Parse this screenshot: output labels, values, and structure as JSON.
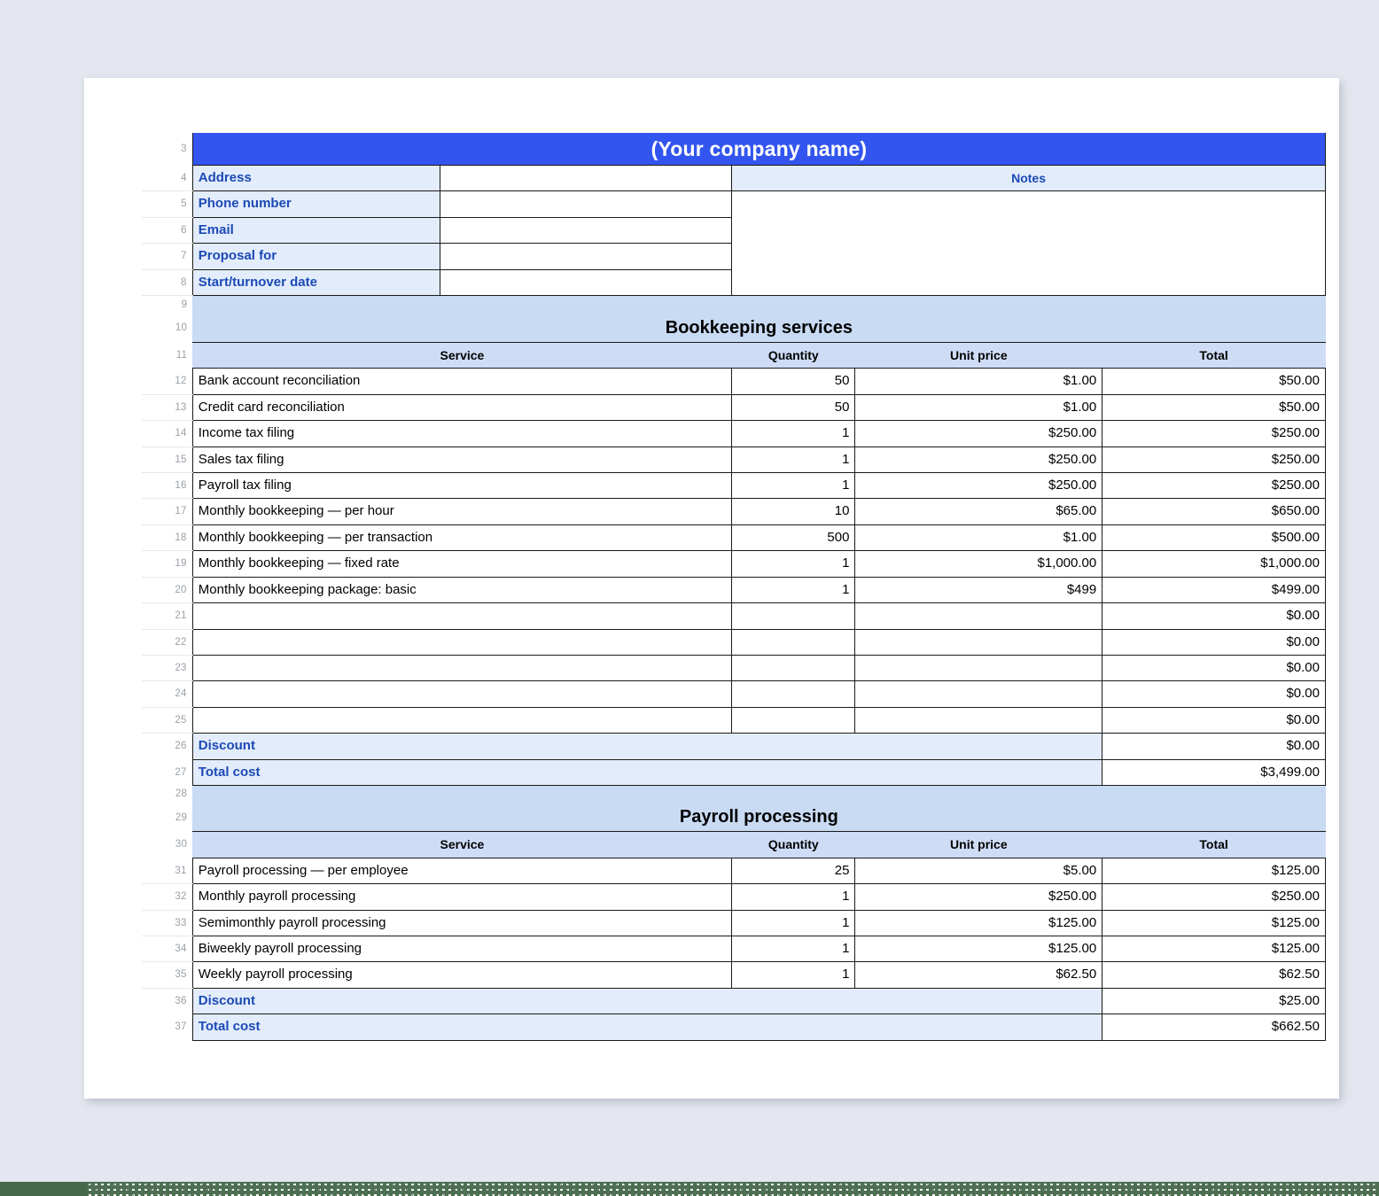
{
  "document": {
    "title": "(Your company name)",
    "notes_header": "Notes"
  },
  "info_rows": [
    {
      "row": "4",
      "label": "Address",
      "value": ""
    },
    {
      "row": "5",
      "label": "Phone number",
      "value": ""
    },
    {
      "row": "6",
      "label": "Email",
      "value": ""
    },
    {
      "row": "7",
      "label": "Proposal for",
      "value": ""
    },
    {
      "row": "8",
      "label": "Start/turnover date",
      "value": ""
    }
  ],
  "row_numbers": {
    "title": "3",
    "spacer9": "9",
    "bk_section": "10",
    "bk_head": "11",
    "spacer28": "28",
    "pr_section": "29",
    "pr_head": "30"
  },
  "columns": {
    "service": "Service",
    "quantity": "Quantity",
    "unit_price": "Unit price",
    "total": "Total"
  },
  "sections": [
    {
      "row_number": "10",
      "header_row_number": "11",
      "name": "Bookkeeping services",
      "rows": [
        {
          "row": "12",
          "service": "Bank account reconciliation",
          "quantity": "50",
          "unit_price": "$1.00",
          "total": "$50.00"
        },
        {
          "row": "13",
          "service": "Credit card reconciliation",
          "quantity": "50",
          "unit_price": "$1.00",
          "total": "$50.00"
        },
        {
          "row": "14",
          "service": "Income tax filing",
          "quantity": "1",
          "unit_price": "$250.00",
          "total": "$250.00"
        },
        {
          "row": "15",
          "service": "Sales tax filing",
          "quantity": "1",
          "unit_price": "$250.00",
          "total": "$250.00"
        },
        {
          "row": "16",
          "service": "Payroll tax filing",
          "quantity": "1",
          "unit_price": "$250.00",
          "total": "$250.00"
        },
        {
          "row": "17",
          "service": "Monthly bookkeeping — per hour",
          "quantity": "10",
          "unit_price": "$65.00",
          "total": "$650.00"
        },
        {
          "row": "18",
          "service": "Monthly bookkeeping — per transaction",
          "quantity": "500",
          "unit_price": "$1.00",
          "total": "$500.00"
        },
        {
          "row": "19",
          "service": "Monthly bookkeeping — fixed rate",
          "quantity": "1",
          "unit_price": "$1,000.00",
          "total": "$1,000.00"
        },
        {
          "row": "20",
          "service": "Monthly bookkeeping package: basic",
          "quantity": "1",
          "unit_price": "$499",
          "total": "$499.00"
        },
        {
          "row": "21",
          "service": "",
          "quantity": "",
          "unit_price": "",
          "total": "$0.00"
        },
        {
          "row": "22",
          "service": "",
          "quantity": "",
          "unit_price": "",
          "total": "$0.00"
        },
        {
          "row": "23",
          "service": "",
          "quantity": "",
          "unit_price": "",
          "total": "$0.00"
        },
        {
          "row": "24",
          "service": "",
          "quantity": "",
          "unit_price": "",
          "total": "$0.00"
        },
        {
          "row": "25",
          "service": "",
          "quantity": "",
          "unit_price": "",
          "total": "$0.00"
        }
      ],
      "discount": {
        "row": "26",
        "label": "Discount",
        "value": "$0.00"
      },
      "total": {
        "row": "27",
        "label": "Total cost",
        "value": "$3,499.00"
      }
    },
    {
      "row_number": "29",
      "header_row_number": "30",
      "name": "Payroll processing",
      "rows": [
        {
          "row": "31",
          "service": "Payroll processing — per employee",
          "quantity": "25",
          "unit_price": "$5.00",
          "total": "$125.00"
        },
        {
          "row": "32",
          "service": "Monthly payroll processing",
          "quantity": "1",
          "unit_price": "$250.00",
          "total": "$250.00"
        },
        {
          "row": "33",
          "service": "Semimonthly payroll processing",
          "quantity": "1",
          "unit_price": "$125.00",
          "total": "$125.00"
        },
        {
          "row": "34",
          "service": "Biweekly payroll processing",
          "quantity": "1",
          "unit_price": "$125.00",
          "total": "$125.00"
        },
        {
          "row": "35",
          "service": "Weekly payroll processing",
          "quantity": "1",
          "unit_price": "$62.50",
          "total": "$62.50"
        }
      ],
      "discount": {
        "row": "36",
        "label": "Discount",
        "value": "$25.00"
      },
      "total": {
        "row": "37",
        "label": "Total cost",
        "value": "$662.50"
      }
    }
  ],
  "theme": {
    "brand_blue": "#3355ef",
    "band_blue": "#c9daf3",
    "label_blue": "#e3ecfb",
    "header_blue": "#cfdcf6",
    "text_blue": "#1b4ab5",
    "footer_green": "#46694a"
  }
}
